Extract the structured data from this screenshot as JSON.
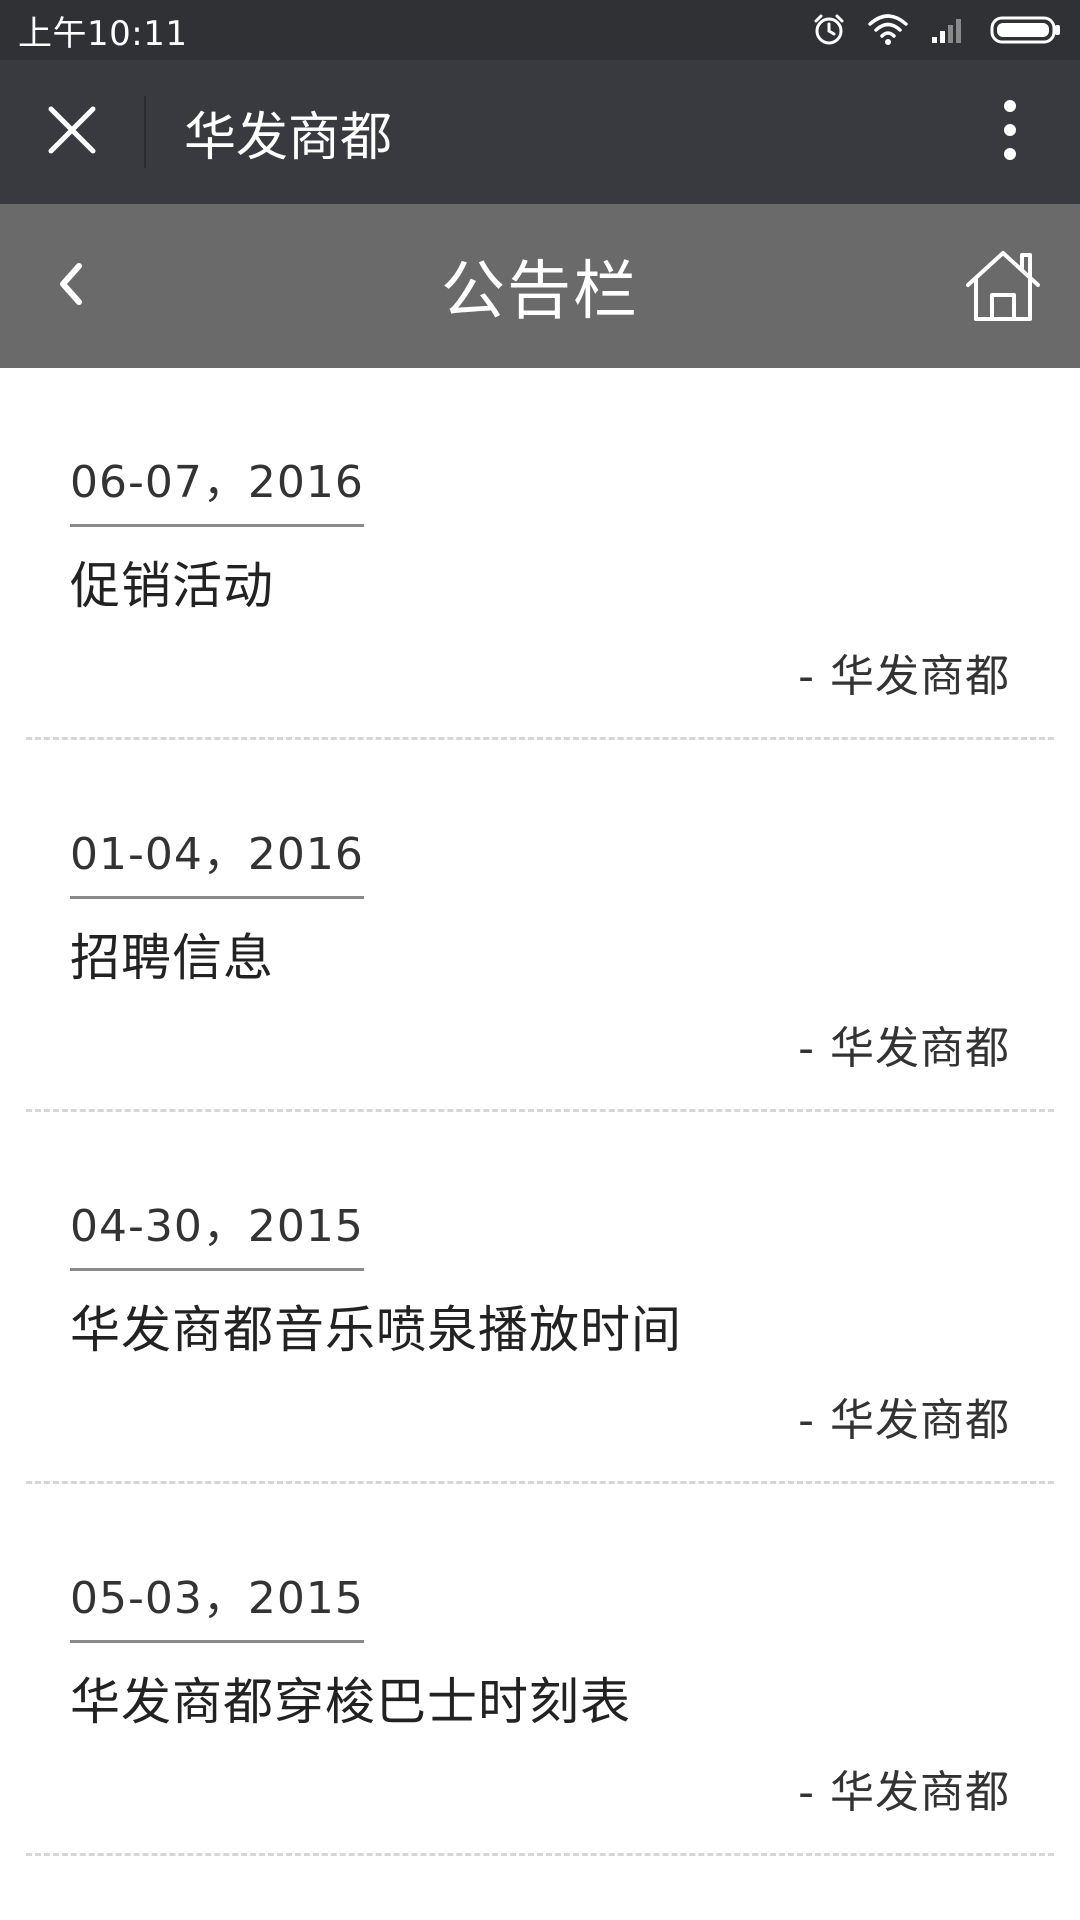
{
  "status_bar": {
    "time": "上午10:11"
  },
  "top_bar": {
    "title": "华发商都"
  },
  "page_header": {
    "title": "公告栏"
  },
  "notices": [
    {
      "date": "06-07，2016",
      "title": "促销活动",
      "author": "- 华发商都"
    },
    {
      "date": "01-04，2016",
      "title": "招聘信息",
      "author": "- 华发商都"
    },
    {
      "date": "04-30，2015",
      "title": "华发商都音乐喷泉播放时间",
      "author": "- 华发商都"
    },
    {
      "date": "05-03，2015",
      "title": "华发商都穿梭巴士时刻表",
      "author": "- 华发商都"
    }
  ],
  "icons": {
    "status": [
      "alarm-icon",
      "wifi-icon",
      "signal-icon",
      "battery-icon"
    ],
    "top_bar": [
      "close-icon",
      "more-vertical-icon"
    ],
    "page_header": [
      "chevron-left-icon",
      "home-icon"
    ]
  },
  "colors": {
    "status_bar": "#303135",
    "top_bar": "#393a3f",
    "page_header": "#6a6a6a",
    "background": "#ffffff"
  }
}
